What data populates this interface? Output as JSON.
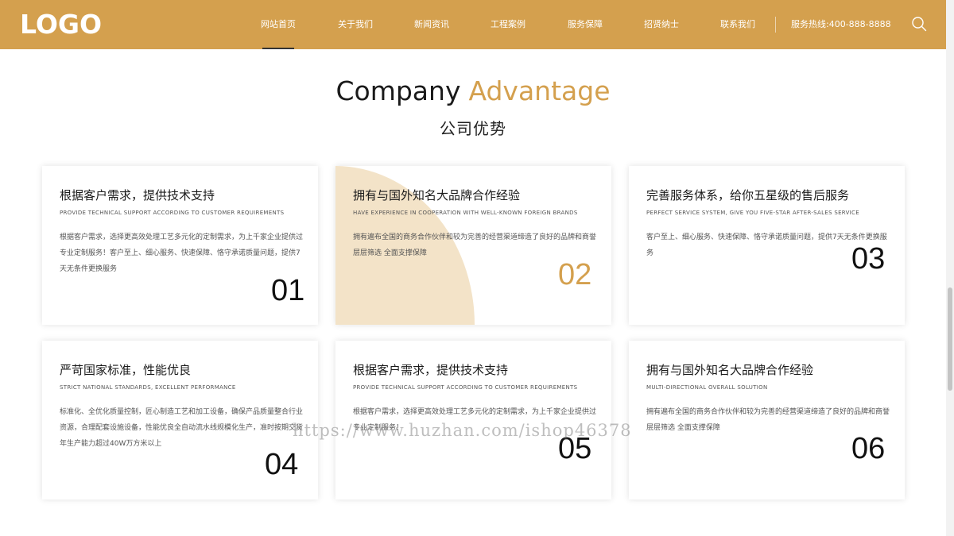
{
  "header": {
    "logo": "LOGO",
    "nav": [
      {
        "label": "网站首页",
        "active": true
      },
      {
        "label": "关于我们"
      },
      {
        "label": "新闻资讯"
      },
      {
        "label": "工程案例"
      },
      {
        "label": "服务保障"
      },
      {
        "label": "招贤纳士"
      },
      {
        "label": "联系我们"
      }
    ],
    "hotline": "服务热线:400-888-8888",
    "search_icon": "search-icon"
  },
  "section": {
    "title_en_1": "Company",
    "title_en_2": "Advantage",
    "title_cn": "公司优势"
  },
  "cards": [
    {
      "title": "根据客户需求，提供技术支持",
      "subtitle": "PROVIDE TECHNICAL SUPPORT ACCORDING TO CUSTOMER REQUIREMENTS",
      "desc": "根据客户需求，选择更高效处理工艺多元化的定制需求，为上千家企业提供过专业定制服务！客户至上、细心服务、快速保障、恪守承诺质量问题，提供7天无条件更换服务",
      "number": "01"
    },
    {
      "title": "拥有与国外知名大品牌合作经验",
      "subtitle": "HAVE EXPERIENCE IN COOPERATION WITH WELL-KNOWN FOREIGN BRANDS",
      "desc": "拥有遍布全国的商务合作伙伴和较为完善的经营渠道缔造了良好的品牌和商誉层层筛选 全面支撑保障",
      "number": "02"
    },
    {
      "title": "完善服务体系，给你五星级的售后服务",
      "subtitle": "PERFECT SERVICE SYSTEM, GIVE YOU FIVE-STAR AFTER-SALES SERVICE",
      "desc": "客户至上、细心服务、快速保障、恪守承诺质量问题，提供7天无条件更换服务",
      "number": "03"
    },
    {
      "title": "严苛国家标准，性能优良",
      "subtitle": "STRICT NATIONAL STANDARDS, EXCELLENT PERFORMANCE",
      "desc": "标准化、全优化质量控制，匠心制造工艺和加工设备，确保产品质量整合行业资源，合理配套设施设备，性能优良全自动流水线规模化生产，准时按期交货年生产能力超过40W万方米以上",
      "number": "04"
    },
    {
      "title": "根据客户需求，提供技术支持",
      "subtitle": "PROVIDE TECHNICAL SUPPORT ACCORDING TO CUSTOMER REQUIREMENTS",
      "desc": "根据客户需求，选择更高效处理工艺多元化的定制需求，为上千家企业提供过专业定制服务！",
      "number": "05"
    },
    {
      "title": "拥有与国外知名大品牌合作经验",
      "subtitle": "MULTI-DIRECTIONAL OVERALL SOLUTION",
      "desc": "拥有遍布全国的商务合作伙伴和较为完善的经营渠道缔造了良好的品牌和商誉层层筛选 全面支撑保障",
      "number": "06"
    }
  ],
  "watermark": "https://www.huzhan.com/ishop46378",
  "colors": {
    "accent": "#d4a04e",
    "accent_light": "#f3e3c8"
  }
}
